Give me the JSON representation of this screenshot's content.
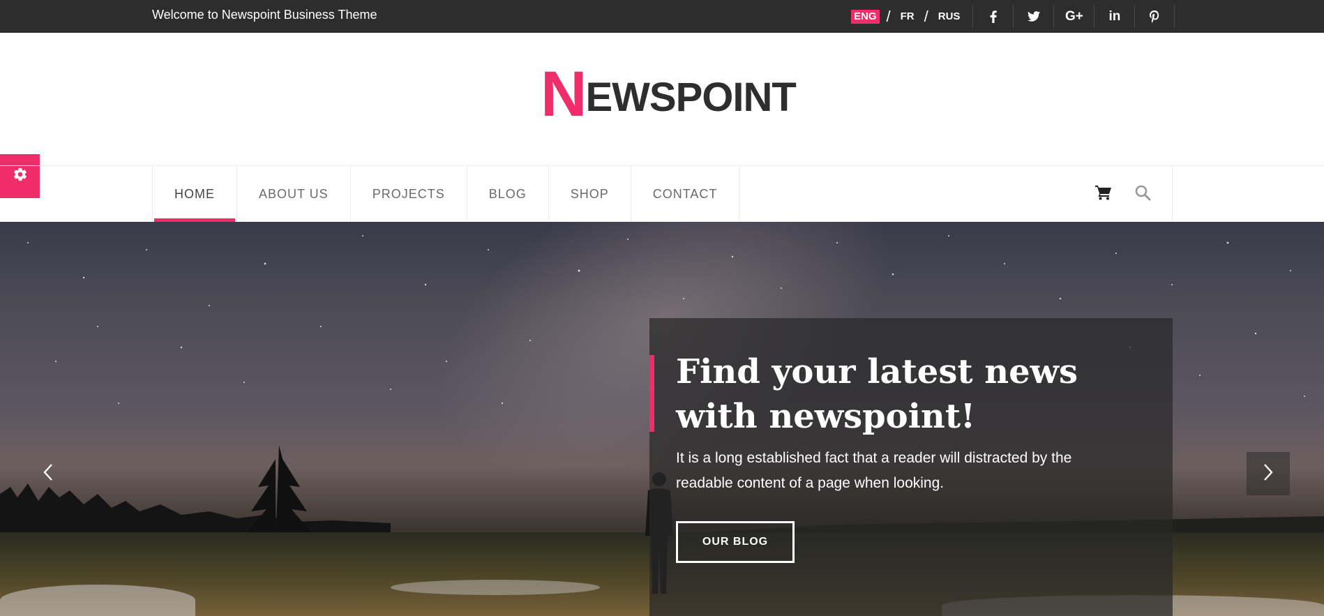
{
  "topbar": {
    "welcome": "Welcome to Newspoint Business Theme",
    "languages": [
      "ENG",
      "FR",
      "RUS"
    ],
    "active_language": "ENG",
    "social": [
      {
        "icon": "facebook-icon",
        "glyph": "f"
      },
      {
        "icon": "twitter-icon",
        "glyph": "t"
      },
      {
        "icon": "google-plus-icon",
        "glyph": "G+"
      },
      {
        "icon": "linkedin-icon",
        "glyph": "in"
      },
      {
        "icon": "pinterest-icon",
        "glyph": "p"
      }
    ]
  },
  "logo": {
    "first": "N",
    "rest": "EWSPOINT"
  },
  "nav": {
    "items": [
      "HOME",
      "ABOUT US",
      "PROJECTS",
      "BLOG",
      "SHOP",
      "CONTACT"
    ],
    "active": "HOME"
  },
  "hero": {
    "title": "Find your latest news with newspoint!",
    "text": "It is a long established fact that a reader will distracted by the readable content of a page when looking.",
    "button": "OUR BLOG"
  },
  "colors": {
    "accent": "#ef2d6a",
    "topbar": "#2d2d2d"
  }
}
